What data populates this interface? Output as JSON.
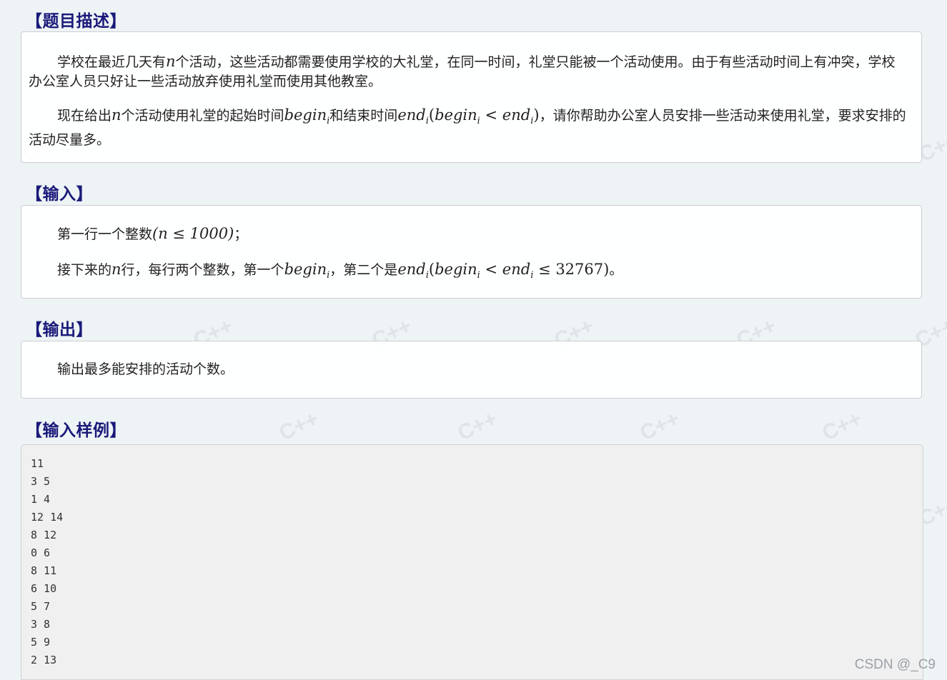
{
  "sections": {
    "desc_title": "【题目描述】",
    "input_title": "【输入】",
    "output_title": "【输出】",
    "sample_title": "【输入样例】"
  },
  "desc": {
    "p1_a": "学校在最近几天有",
    "p1_b": "个活动，这些活动都需要使用学校的大礼堂，在同一时间，礼堂只能被一个活动使用。由于有些活动时间上有冲突，学校办公室人员只好让一些活动放弃使用礼堂而使用其他教室。",
    "p2_a": "现在给出",
    "p2_b": "个活动使用礼堂的起始时间",
    "p2_c": "和结束时间",
    "p2_d": "，请你帮助办公室人员安排一些活动来使用礼堂，要求安排的活动尽量多。"
  },
  "input": {
    "l1_a": "第一行一个整数",
    "l1_b": "；",
    "l2_a": "接下来的",
    "l2_b": "行，每行两个整数，第一个",
    "l2_c": "，第二个是",
    "l2_d": "。"
  },
  "math": {
    "n": "n",
    "begin": "begin",
    "end": "end",
    "i": "i",
    "lt": " < ",
    "le": " ≤ ",
    "n1000": "(n ≤ 1000)",
    "max": "32767",
    "lp": "(",
    "rp": ")"
  },
  "output": {
    "text": "输出最多能安排的活动个数。"
  },
  "sample_lines": [
    "11",
    "3 5",
    "1 4",
    "12 14",
    "8 12",
    "0 6",
    "8 11",
    "6 10",
    "5 7",
    "3 8",
    "5 9",
    "2 13"
  ],
  "watermark": {
    "text": "C++",
    "brand": "CSDN @_C9"
  }
}
